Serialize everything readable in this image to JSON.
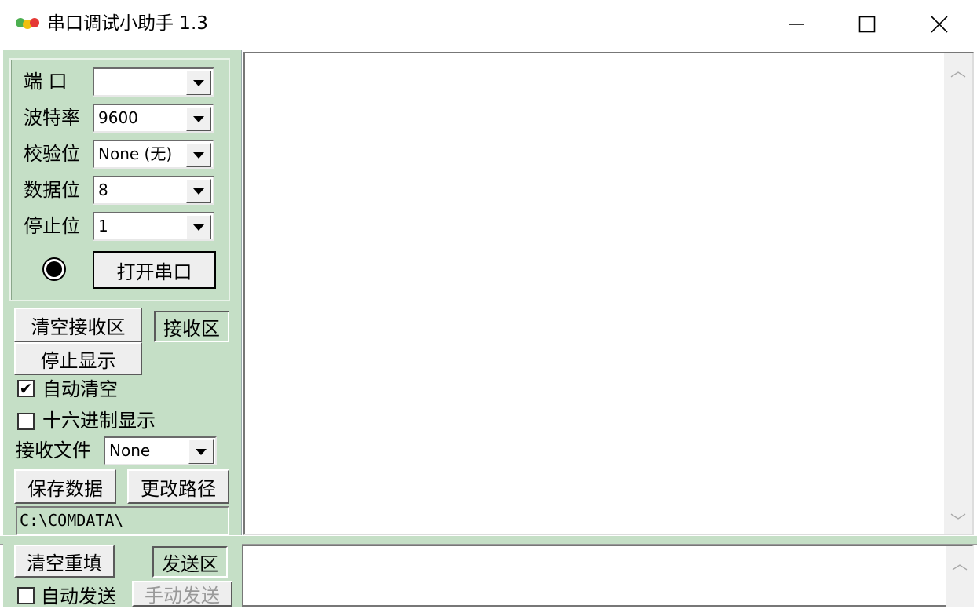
{
  "window": {
    "title": "串口调试小助手 1.3",
    "controls": {
      "minimize": "minimize-icon",
      "maximize": "maximize-icon",
      "close": "close-icon"
    }
  },
  "settings": {
    "port": {
      "label": "端  口",
      "value": ""
    },
    "baud": {
      "label": "波特率",
      "value": "9600"
    },
    "parity": {
      "label": "校验位",
      "value": "None (无)"
    },
    "databits": {
      "label": "数据位",
      "value": "8"
    },
    "stopbits": {
      "label": "停止位",
      "value": "1"
    },
    "open_button": "打开串口"
  },
  "receive": {
    "clear_button": "清空接收区",
    "area_button": "接收区",
    "stop_button": "停止显示",
    "auto_clear_label": "自动清空",
    "auto_clear_checked": true,
    "hex_label": "十六进制显示",
    "hex_checked": false,
    "file_label": "接收文件",
    "file_value": "None",
    "save_button": "保存数据",
    "change_path_button": "更改路径",
    "path": "C:\\COMDATA\\"
  },
  "send": {
    "clear_button": "清空重填",
    "area_button": "发送区",
    "auto_send_label": "自动发送",
    "auto_send_checked": false,
    "manual_send_button": "手动发送"
  },
  "colors": {
    "panel": "#c5dfc6",
    "background": "#ffffff"
  }
}
